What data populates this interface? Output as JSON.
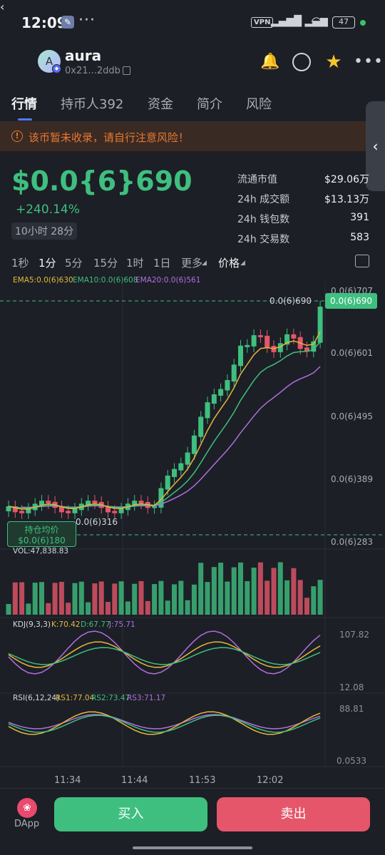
{
  "status_bar": {
    "time": "12:09",
    "vpn": "VPN",
    "network": "HD",
    "battery": "47"
  },
  "token": {
    "name": "aura",
    "avatar_letter": "A",
    "address": "0x21...2ddb"
  },
  "tabs": [
    "行情",
    "持币人392",
    "资金",
    "简介",
    "风险"
  ],
  "warning": "该币暂未收录，请自行注意风险！",
  "price": {
    "value": "$0.0{6}690",
    "change": "+240.14%",
    "age": "10小时 28分"
  },
  "stats": [
    {
      "label": "流通市值",
      "value": "$29.06万"
    },
    {
      "label": "24h 成交额",
      "value": "$13.13万"
    },
    {
      "label": "24h 钱包数",
      "value": "391"
    },
    {
      "label": "24h 交易数",
      "value": "583"
    }
  ],
  "intervals": [
    "1秒",
    "1分",
    "5分",
    "15分",
    "1时",
    "1日",
    "更多",
    "价格"
  ],
  "active_interval": "1分",
  "ema_legend": {
    "ema5": "EMA5:0.0(6)630",
    "ema10": "EMA10:0.0(6)608",
    "ema20": "EMA20:0.0(6)561"
  },
  "price_axis": {
    "top": "0.0(6)707",
    "last": "0.0(6)690",
    "t1": "0.0(6)601",
    "t2": "0.0(6)495",
    "t3": "0.0(6)389",
    "bottom": "0.0(6)283",
    "last_line_label": "0.0(6)690",
    "low_label": "0.0(6)316"
  },
  "cost_box": {
    "title": "持仓均价",
    "value": "$0.0(6)180"
  },
  "volume": {
    "label": "VOL:47,838.83"
  },
  "kdj": {
    "label": "KDJ(9,3,3)",
    "k": "K:70.42",
    "d": "D:67.77",
    "j": "J:75.71",
    "max": "107.82",
    "min": "12.08"
  },
  "rsi": {
    "label": "RSI(6,12,24)",
    "rsi1": "RS1:77.04",
    "rsi2": "RS2:73.47",
    "rsi3": "RS3:71.17",
    "max": "88.81",
    "min": "0.0533"
  },
  "time_labels": [
    "11:34",
    "11:44",
    "11:53",
    "12:02"
  ],
  "bottom_bar": {
    "dapp": "DApp",
    "buy": "买入",
    "sell": "卖出"
  },
  "colors": {
    "up": "#3fbf7f",
    "down": "#e5566a",
    "ema5": "#e6b73a",
    "ema10": "#3fbf7f",
    "ema20": "#b06fe0",
    "accent": "#4a7cff",
    "warning": "#e8792f"
  }
}
